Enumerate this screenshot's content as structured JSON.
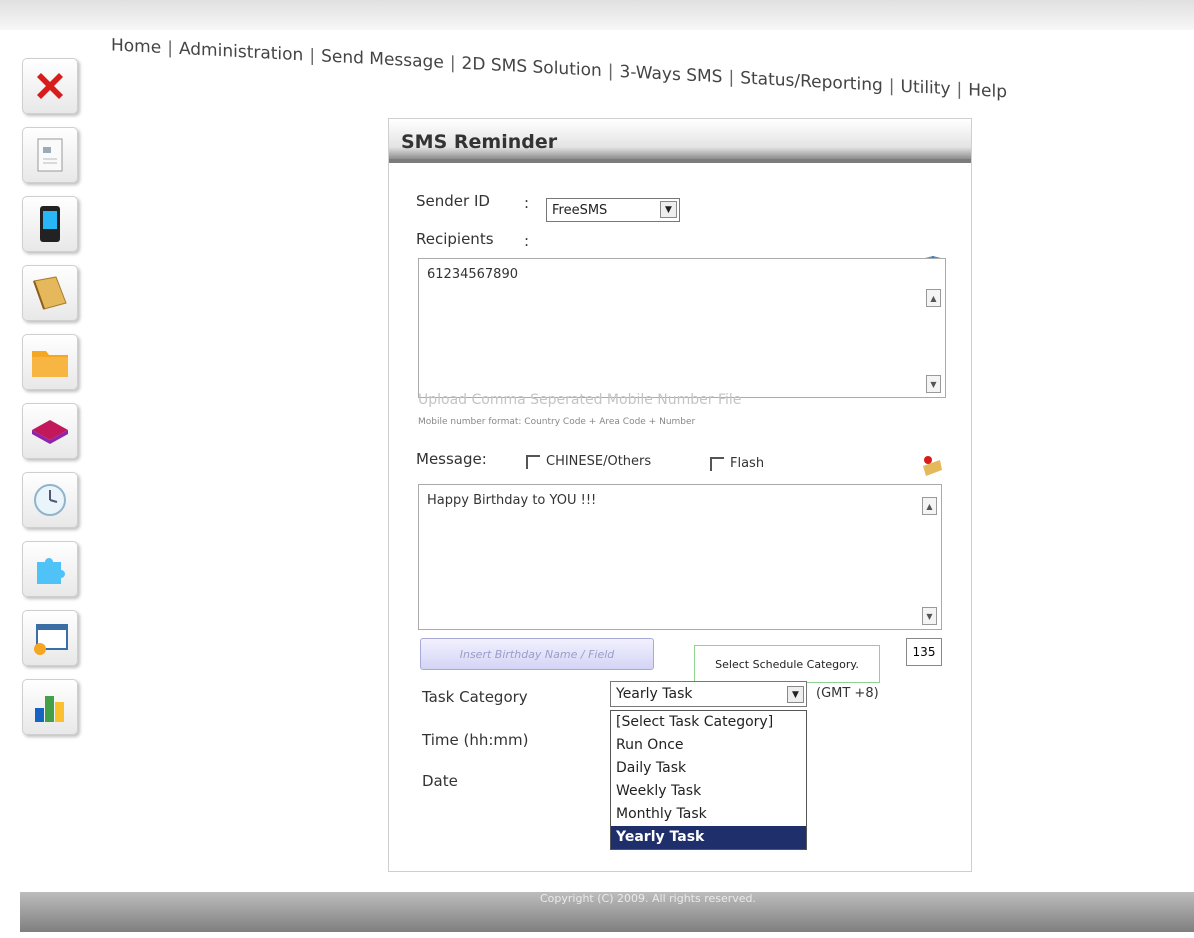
{
  "nav": {
    "items": [
      "Home",
      "Administration",
      "Send Message",
      "2D SMS Solution",
      "3-Ways SMS",
      "Status/Reporting",
      "Utility",
      "Help"
    ],
    "separator": "|"
  },
  "sidebar": {
    "icons": [
      "close-icon",
      "document-icon",
      "phone-icon",
      "note-icon",
      "folder-icon",
      "book-icon",
      "clock-icon",
      "puzzle-icon",
      "window-icon",
      "chart-icon"
    ]
  },
  "panel": {
    "title": "SMS Reminder",
    "sender_label": "Sender ID",
    "colon": ":",
    "sender_value": "FreeSMS",
    "recipients_label": "Recipients",
    "recipients_value": "61234567890",
    "upload_text": "Upload Comma Seperated Mobile Number File",
    "format_text": "Mobile number format: Country Code + Area Code + Number",
    "message_label": "Message:",
    "chinese_label": "CHINESE/Others",
    "flash_label": "Flash",
    "message_value": "Happy Birthday to YOU !!!",
    "counter": "135",
    "browse_label": "Insert Birthday Name / Field",
    "tooltip": "Select Schedule Category.",
    "task_label": "Task Category",
    "task_value": "Yearly Task",
    "gmt": "(GMT +8)",
    "time_label": "Time (hh:mm)",
    "date_label": "Date",
    "task_options": [
      "[Select Task Category]",
      "Run Once",
      "Daily Task",
      "Weekly Task",
      "Monthly Task",
      "Yearly Task"
    ]
  },
  "footer": {
    "text": "Copyright (C) 2009. All rights reserved."
  }
}
